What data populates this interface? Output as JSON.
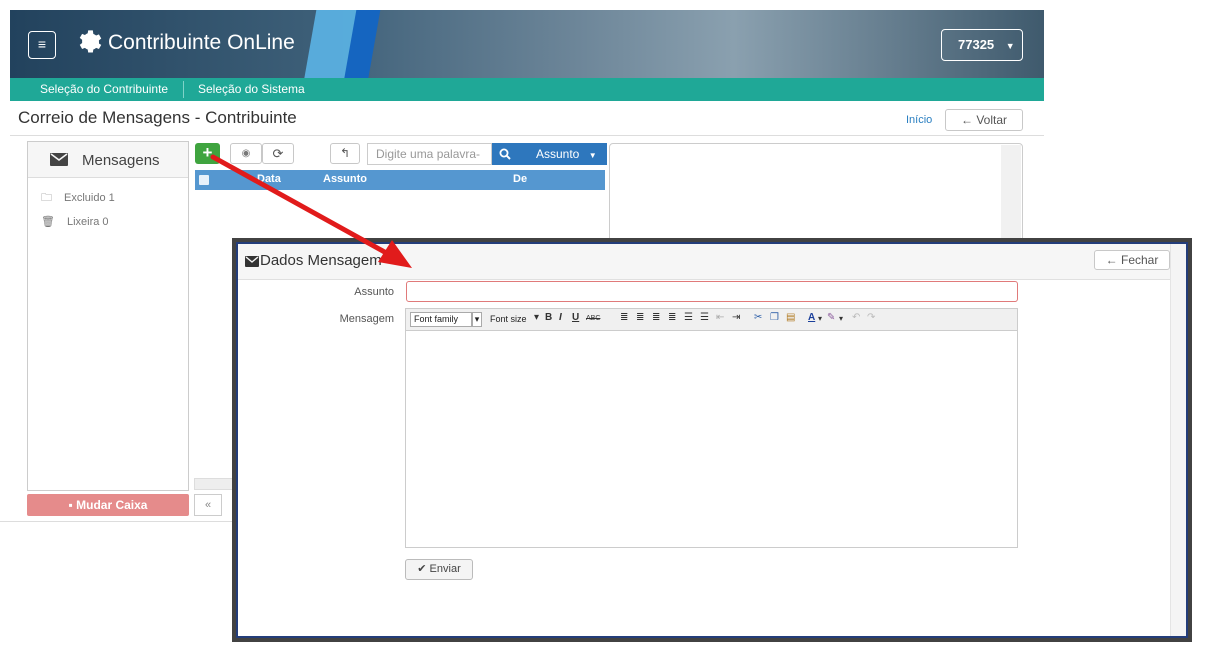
{
  "header": {
    "app_title": "Contribuinte OnLine",
    "user_code": "77325",
    "menu_icon": "hamburger-icon",
    "logo_icon": "gear-icon"
  },
  "nav": {
    "items": [
      {
        "label": "Seleção do Contribuinte"
      },
      {
        "label": "Seleção do Sistema"
      }
    ]
  },
  "page": {
    "title": "Correio de Mensagens - Contribuinte",
    "home_link": "Início",
    "back_label": "Voltar"
  },
  "mailbox": {
    "heading": "Mensagens",
    "folders": [
      {
        "label": "Excluido 1",
        "icon": "folder-icon"
      },
      {
        "label": "Lixeira 0",
        "icon": "trash-icon"
      }
    ],
    "change_box_label": "Mudar Caixa"
  },
  "toolbar": {
    "search_placeholder": "Digite uma palavra-",
    "filter_label": "Assunto"
  },
  "table": {
    "columns": [
      "Data",
      "Assunto",
      "De"
    ]
  },
  "pager": {
    "prev": "«"
  },
  "modal": {
    "title": "Dados Mensagem",
    "close_label": "Fechar",
    "subject_label": "Assunto",
    "subject_value": "",
    "message_label": "Mensagem",
    "font_family": "Font family",
    "font_size": "Font size",
    "send_label": "Enviar"
  },
  "colors": {
    "nav": "#1fa897",
    "primary": "#2e77bd",
    "success": "#3fa43f",
    "danger": "#e58b8b",
    "arrow": "#e11b1b"
  }
}
